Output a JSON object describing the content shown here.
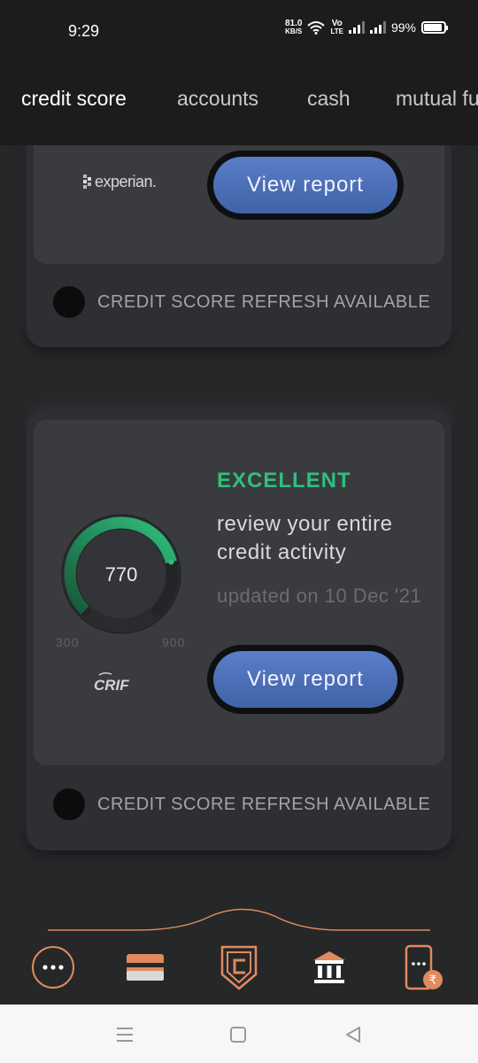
{
  "status_bar": {
    "time": "9:29",
    "speed_value": "81.0",
    "speed_unit": "KB/S",
    "volte": "Vo",
    "lte": "LTE",
    "battery": "99%"
  },
  "tabs": [
    {
      "label": "credit score",
      "active": true
    },
    {
      "label": "accounts",
      "active": false
    },
    {
      "label": "cash",
      "active": false
    },
    {
      "label": "mutual funds",
      "active": false
    }
  ],
  "cards": [
    {
      "bureau": "experian.",
      "button_label": "View report",
      "refresh_text": "CREDIT SCORE REFRESH AVAILABLE"
    },
    {
      "rating": "EXCELLENT",
      "description": "review your entire credit activity",
      "updated": "updated on 10 Dec '21",
      "score": "770",
      "range_min": "300",
      "range_max": "900",
      "score_fraction": 0.7833,
      "bureau": "CRIF",
      "button_label": "View report",
      "refresh_text": "CREDIT SCORE REFRESH AVAILABLE"
    }
  ],
  "colors": {
    "accent": "#e08a5f",
    "excellent": "#2fbf7d",
    "button": "#4a6db5",
    "background": "#262729"
  },
  "bottom_nav": [
    {
      "icon": "more-dots-icon"
    },
    {
      "icon": "credit-card-icon"
    },
    {
      "icon": "credit-score-shield-icon"
    },
    {
      "icon": "bank-icon"
    },
    {
      "icon": "phone-rupee-icon"
    }
  ],
  "system_nav": [
    {
      "icon": "menu-lines-icon"
    },
    {
      "icon": "home-square-icon"
    },
    {
      "icon": "back-triangle-icon"
    }
  ]
}
